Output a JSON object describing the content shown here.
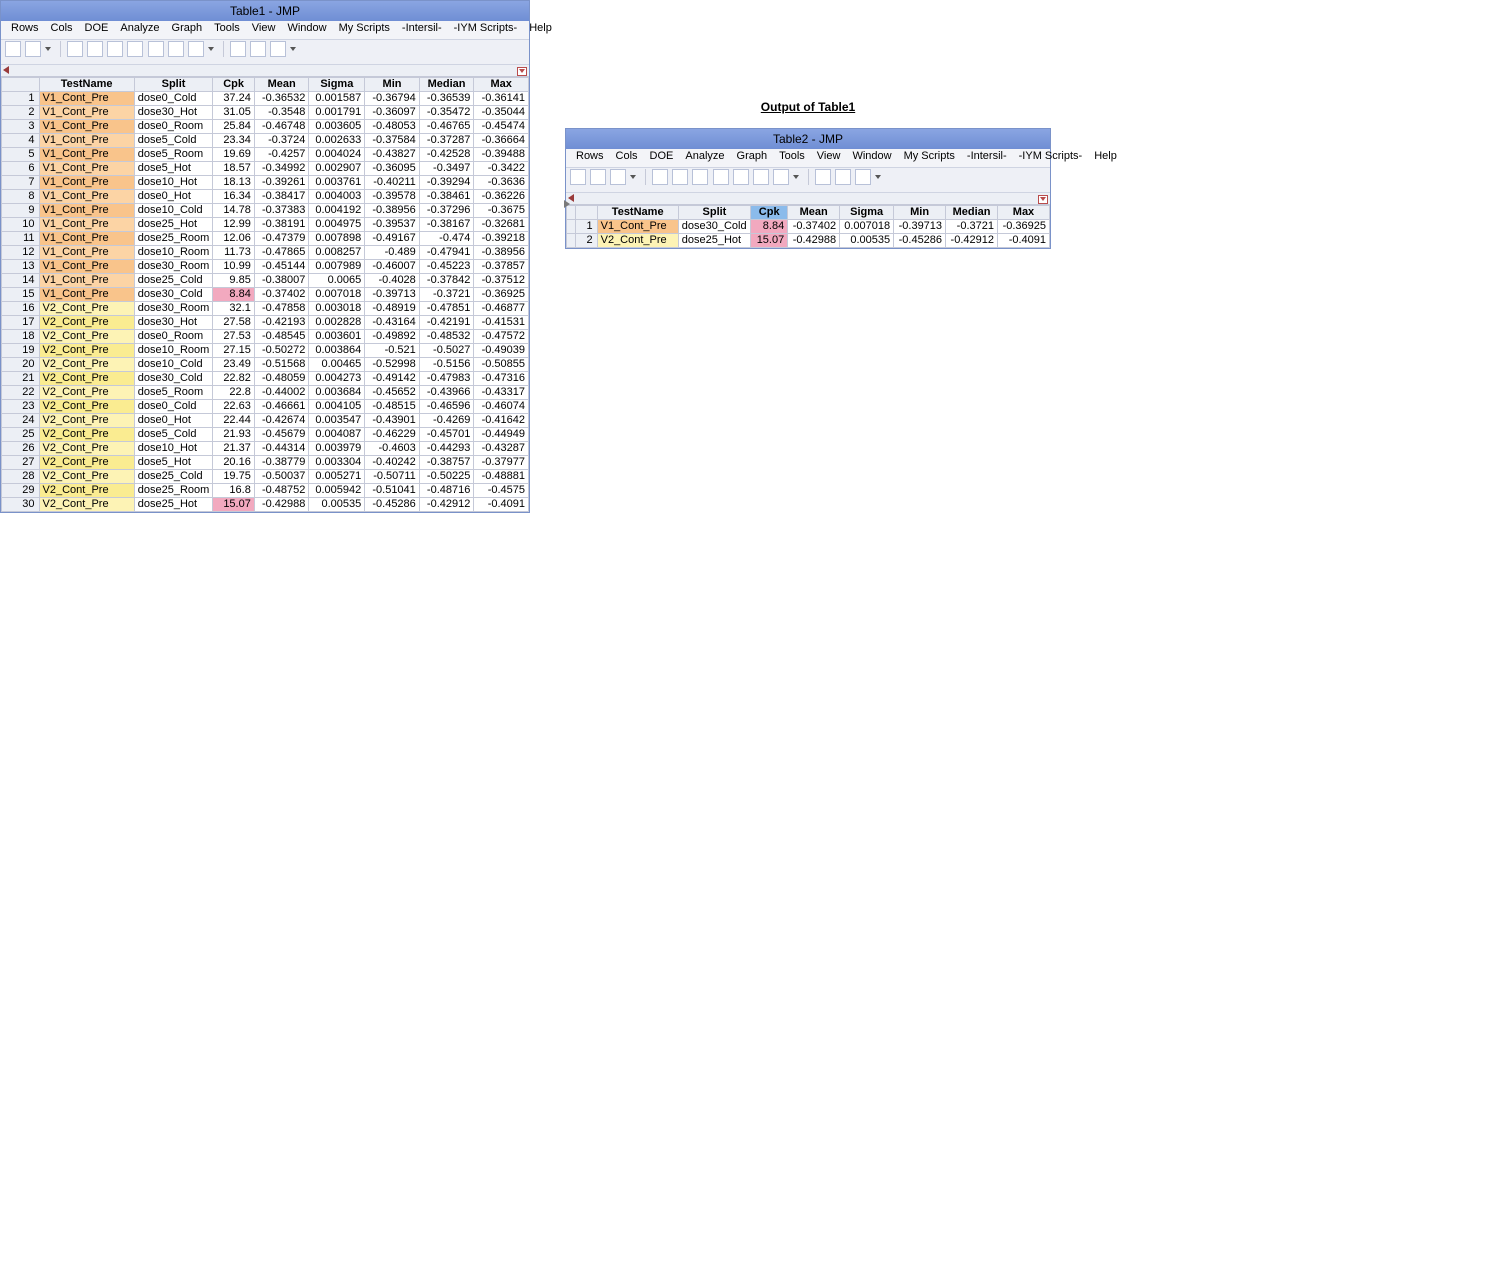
{
  "win1": {
    "title": "Table1 - JMP"
  },
  "win2": {
    "title": "Table2 - JMP"
  },
  "sec2_head": "Output of Table1",
  "menu": [
    "Rows",
    "Cols",
    "DOE",
    "Analyze",
    "Graph",
    "Tools",
    "View",
    "Window",
    "My Scripts",
    "-Intersil-",
    "-IYM Scripts-",
    "Help"
  ],
  "hdr": [
    "TestName",
    "Split",
    "Cpk",
    "Mean",
    "Sigma",
    "Min",
    "Median",
    "Max"
  ],
  "widths": [
    112,
    68,
    42,
    52,
    52,
    52,
    52,
    52
  ],
  "rows": [
    {
      "n": 1,
      "tn": "V1_Cont_Pre",
      "sp": "dose0_Cold",
      "cpk": "37.24",
      "mean": "-0.36532",
      "sig": "0.001587",
      "min": "-0.36794",
      "med": "-0.36539",
      "max": "-0.36141",
      "cls": "bg-orange"
    },
    {
      "n": 2,
      "tn": "V1_Cont_Pre",
      "sp": "dose30_Hot",
      "cpk": "31.05",
      "mean": "-0.3548",
      "sig": "0.001791",
      "min": "-0.36097",
      "med": "-0.35472",
      "max": "-0.35044",
      "cls": "bg-orange-l"
    },
    {
      "n": 3,
      "tn": "V1_Cont_Pre",
      "sp": "dose0_Room",
      "cpk": "25.84",
      "mean": "-0.46748",
      "sig": "0.003605",
      "min": "-0.48053",
      "med": "-0.46765",
      "max": "-0.45474",
      "cls": "bg-orange"
    },
    {
      "n": 4,
      "tn": "V1_Cont_Pre",
      "sp": "dose5_Cold",
      "cpk": "23.34",
      "mean": "-0.3724",
      "sig": "0.002633",
      "min": "-0.37584",
      "med": "-0.37287",
      "max": "-0.36664",
      "cls": "bg-orange-l"
    },
    {
      "n": 5,
      "tn": "V1_Cont_Pre",
      "sp": "dose5_Room",
      "cpk": "19.69",
      "mean": "-0.4257",
      "sig": "0.004024",
      "min": "-0.43827",
      "med": "-0.42528",
      "max": "-0.39488",
      "cls": "bg-orange"
    },
    {
      "n": 6,
      "tn": "V1_Cont_Pre",
      "sp": "dose5_Hot",
      "cpk": "18.57",
      "mean": "-0.34992",
      "sig": "0.002907",
      "min": "-0.36095",
      "med": "-0.3497",
      "max": "-0.3422",
      "cls": "bg-orange-l"
    },
    {
      "n": 7,
      "tn": "V1_Cont_Pre",
      "sp": "dose10_Hot",
      "cpk": "18.13",
      "mean": "-0.39261",
      "sig": "0.003761",
      "min": "-0.40211",
      "med": "-0.39294",
      "max": "-0.3636",
      "cls": "bg-orange"
    },
    {
      "n": 8,
      "tn": "V1_Cont_Pre",
      "sp": "dose0_Hot",
      "cpk": "16.34",
      "mean": "-0.38417",
      "sig": "0.004003",
      "min": "-0.39578",
      "med": "-0.38461",
      "max": "-0.36226",
      "cls": "bg-orange-l"
    },
    {
      "n": 9,
      "tn": "V1_Cont_Pre",
      "sp": "dose10_Cold",
      "cpk": "14.78",
      "mean": "-0.37383",
      "sig": "0.004192",
      "min": "-0.38956",
      "med": "-0.37296",
      "max": "-0.3675",
      "cls": "bg-orange"
    },
    {
      "n": 10,
      "tn": "V1_Cont_Pre",
      "sp": "dose25_Hot",
      "cpk": "12.99",
      "mean": "-0.38191",
      "sig": "0.004975",
      "min": "-0.39537",
      "med": "-0.38167",
      "max": "-0.32681",
      "cls": "bg-orange-l"
    },
    {
      "n": 11,
      "tn": "V1_Cont_Pre",
      "sp": "dose25_Room",
      "cpk": "12.06",
      "mean": "-0.47379",
      "sig": "0.007898",
      "min": "-0.49167",
      "med": "-0.474",
      "max": "-0.39218",
      "cls": "bg-orange"
    },
    {
      "n": 12,
      "tn": "V1_Cont_Pre",
      "sp": "dose10_Room",
      "cpk": "11.73",
      "mean": "-0.47865",
      "sig": "0.008257",
      "min": "-0.489",
      "med": "-0.47941",
      "max": "-0.38956",
      "cls": "bg-orange-l"
    },
    {
      "n": 13,
      "tn": "V1_Cont_Pre",
      "sp": "dose30_Room",
      "cpk": "10.99",
      "mean": "-0.45144",
      "sig": "0.007989",
      "min": "-0.46007",
      "med": "-0.45223",
      "max": "-0.37857",
      "cls": "bg-orange"
    },
    {
      "n": 14,
      "tn": "V1_Cont_Pre",
      "sp": "dose25_Cold",
      "cpk": "9.85",
      "mean": "-0.38007",
      "sig": "0.0065",
      "min": "-0.4028",
      "med": "-0.37842",
      "max": "-0.37512",
      "cls": "bg-orange-l"
    },
    {
      "n": 15,
      "tn": "V1_Cont_Pre",
      "sp": "dose30_Cold",
      "cpk": "8.84",
      "mean": "-0.37402",
      "sig": "0.007018",
      "min": "-0.39713",
      "med": "-0.3721",
      "max": "-0.36925",
      "cls": "bg-orange",
      "cpkcls": "hl-pink"
    },
    {
      "n": 16,
      "tn": "V2_Cont_Pre",
      "sp": "dose30_Room",
      "cpk": "32.1",
      "mean": "-0.47858",
      "sig": "0.003018",
      "min": "-0.48919",
      "med": "-0.47851",
      "max": "-0.46877",
      "cls": "bg-yellow-l"
    },
    {
      "n": 17,
      "tn": "V2_Cont_Pre",
      "sp": "dose30_Hot",
      "cpk": "27.58",
      "mean": "-0.42193",
      "sig": "0.002828",
      "min": "-0.43164",
      "med": "-0.42191",
      "max": "-0.41531",
      "cls": "bg-yellow"
    },
    {
      "n": 18,
      "tn": "V2_Cont_Pre",
      "sp": "dose0_Room",
      "cpk": "27.53",
      "mean": "-0.48545",
      "sig": "0.003601",
      "min": "-0.49892",
      "med": "-0.48532",
      "max": "-0.47572",
      "cls": "bg-yellow-l"
    },
    {
      "n": 19,
      "tn": "V2_Cont_Pre",
      "sp": "dose10_Room",
      "cpk": "27.15",
      "mean": "-0.50272",
      "sig": "0.003864",
      "min": "-0.521",
      "med": "-0.5027",
      "max": "-0.49039",
      "cls": "bg-yellow"
    },
    {
      "n": 20,
      "tn": "V2_Cont_Pre",
      "sp": "dose10_Cold",
      "cpk": "23.49",
      "mean": "-0.51568",
      "sig": "0.00465",
      "min": "-0.52998",
      "med": "-0.5156",
      "max": "-0.50855",
      "cls": "bg-yellow-l"
    },
    {
      "n": 21,
      "tn": "V2_Cont_Pre",
      "sp": "dose30_Cold",
      "cpk": "22.82",
      "mean": "-0.48059",
      "sig": "0.004273",
      "min": "-0.49142",
      "med": "-0.47983",
      "max": "-0.47316",
      "cls": "bg-yellow"
    },
    {
      "n": 22,
      "tn": "V2_Cont_Pre",
      "sp": "dose5_Room",
      "cpk": "22.8",
      "mean": "-0.44002",
      "sig": "0.003684",
      "min": "-0.45652",
      "med": "-0.43966",
      "max": "-0.43317",
      "cls": "bg-yellow-l"
    },
    {
      "n": 23,
      "tn": "V2_Cont_Pre",
      "sp": "dose0_Cold",
      "cpk": "22.63",
      "mean": "-0.46661",
      "sig": "0.004105",
      "min": "-0.48515",
      "med": "-0.46596",
      "max": "-0.46074",
      "cls": "bg-yellow"
    },
    {
      "n": 24,
      "tn": "V2_Cont_Pre",
      "sp": "dose0_Hot",
      "cpk": "22.44",
      "mean": "-0.42674",
      "sig": "0.003547",
      "min": "-0.43901",
      "med": "-0.4269",
      "max": "-0.41642",
      "cls": "bg-yellow-l"
    },
    {
      "n": 25,
      "tn": "V2_Cont_Pre",
      "sp": "dose5_Cold",
      "cpk": "21.93",
      "mean": "-0.45679",
      "sig": "0.004087",
      "min": "-0.46229",
      "med": "-0.45701",
      "max": "-0.44949",
      "cls": "bg-yellow"
    },
    {
      "n": 26,
      "tn": "V2_Cont_Pre",
      "sp": "dose10_Hot",
      "cpk": "21.37",
      "mean": "-0.44314",
      "sig": "0.003979",
      "min": "-0.4603",
      "med": "-0.44293",
      "max": "-0.43287",
      "cls": "bg-yellow-l"
    },
    {
      "n": 27,
      "tn": "V2_Cont_Pre",
      "sp": "dose5_Hot",
      "cpk": "20.16",
      "mean": "-0.38779",
      "sig": "0.003304",
      "min": "-0.40242",
      "med": "-0.38757",
      "max": "-0.37977",
      "cls": "bg-yellow"
    },
    {
      "n": 28,
      "tn": "V2_Cont_Pre",
      "sp": "dose25_Cold",
      "cpk": "19.75",
      "mean": "-0.50037",
      "sig": "0.005271",
      "min": "-0.50711",
      "med": "-0.50225",
      "max": "-0.48881",
      "cls": "bg-yellow-l"
    },
    {
      "n": 29,
      "tn": "V2_Cont_Pre",
      "sp": "dose25_Room",
      "cpk": "16.8",
      "mean": "-0.48752",
      "sig": "0.005942",
      "min": "-0.51041",
      "med": "-0.48716",
      "max": "-0.4575",
      "cls": "bg-yellow"
    },
    {
      "n": 30,
      "tn": "V2_Cont_Pre",
      "sp": "dose25_Hot",
      "cpk": "15.07",
      "mean": "-0.42988",
      "sig": "0.00535",
      "min": "-0.45286",
      "med": "-0.42912",
      "max": "-0.4091",
      "cls": "bg-yellow-l",
      "cpkcls": "hl-pink"
    }
  ],
  "rows2": [
    {
      "n": 1,
      "tn": "V1_Cont_Pre",
      "sp": "dose30_Cold",
      "cpk": "8.84",
      "mean": "-0.37402",
      "sig": "0.007018",
      "min": "-0.39713",
      "med": "-0.3721",
      "max": "-0.36925",
      "cls": "bg-orange",
      "rncls": "hl-blue",
      "cpkcls": "hl-pink"
    },
    {
      "n": 2,
      "tn": "V2_Cont_Pre",
      "sp": "dose25_Hot",
      "cpk": "15.07",
      "mean": "-0.42988",
      "sig": "0.00535",
      "min": "-0.45286",
      "med": "-0.42912",
      "max": "-0.4091",
      "cls": "bg-yellow-l",
      "rncls": "hl-blue",
      "cpkcls": "hl-pink"
    }
  ]
}
